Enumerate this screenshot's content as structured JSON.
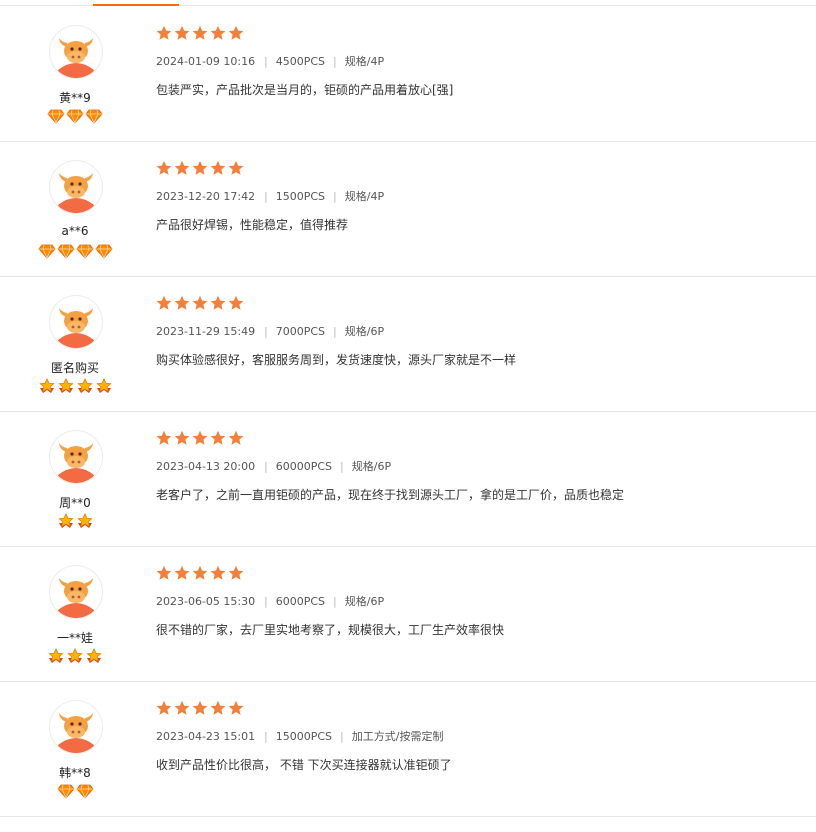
{
  "colors": {
    "accent": "#ff6a00",
    "star": "#f3803a",
    "avatar_face": "#f4a043",
    "avatar_body": "#f26b43"
  },
  "icons": {
    "star": "star-icon",
    "diamond": "diamond-badge-icon",
    "crown": "crown-star-badge-icon",
    "avatar": "bull-avatar-icon"
  },
  "reviews": [
    {
      "user": "黄**9",
      "badge_type": "diamond",
      "badge_count": 3,
      "rating": 5,
      "date": "2024-01-09 10:16",
      "quantity": "4500PCS",
      "spec": "规格/4P",
      "comment": "包装严实，产品批次是当月的，钜硕的产品用着放心[强]"
    },
    {
      "user": "a**6",
      "badge_type": "diamond",
      "badge_count": 4,
      "rating": 5,
      "date": "2023-12-20 17:42",
      "quantity": "1500PCS",
      "spec": "规格/4P",
      "comment": "产品很好焊锡，性能稳定，值得推荐"
    },
    {
      "user": "匿名购买",
      "badge_type": "crown",
      "badge_count": 4,
      "rating": 5,
      "date": "2023-11-29 15:49",
      "quantity": "7000PCS",
      "spec": "规格/6P",
      "comment": "购买体验感很好，客服服务周到，发货速度快，源头厂家就是不一样"
    },
    {
      "user": "周**0",
      "badge_type": "crown",
      "badge_count": 2,
      "rating": 5,
      "date": "2023-04-13 20:00",
      "quantity": "60000PCS",
      "spec": "规格/6P",
      "comment": "老客户了，之前一直用钜硕的产品，现在终于找到源头工厂，拿的是工厂价，品质也稳定"
    },
    {
      "user": "一**娃",
      "badge_type": "crown",
      "badge_count": 3,
      "rating": 5,
      "date": "2023-06-05 15:30",
      "quantity": "6000PCS",
      "spec": "规格/6P",
      "comment": "很不错的厂家，去厂里实地考察了，规模很大，工厂生产效率很快"
    },
    {
      "user": "韩**8",
      "badge_type": "diamond",
      "badge_count": 2,
      "rating": 5,
      "date": "2023-04-23 15:01",
      "quantity": "15000PCS",
      "spec": "加工方式/按需定制",
      "comment": "收到产品性价比很高， 不错 下次买连接器就认准钜硕了"
    }
  ]
}
